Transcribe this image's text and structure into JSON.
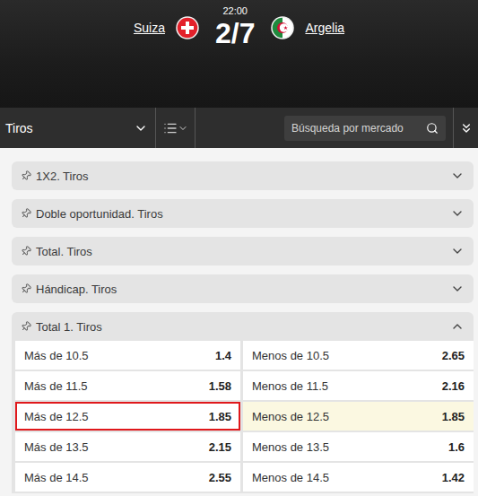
{
  "match": {
    "time": "22:00",
    "score": "2/7",
    "home": {
      "name": "Suiza"
    },
    "away": {
      "name": "Argelia"
    }
  },
  "toolbar": {
    "category": "Tiros",
    "search": {
      "placeholder": "Búsqueda por mercado"
    }
  },
  "markets": [
    {
      "title": "1X2. Tiros",
      "expanded": false,
      "rows": []
    },
    {
      "title": "Doble oportunidad. Tiros",
      "expanded": false,
      "rows": []
    },
    {
      "title": "Total. Tiros",
      "expanded": false,
      "rows": []
    },
    {
      "title": "Hándicap. Tiros",
      "expanded": false,
      "rows": []
    },
    {
      "title": "Total 1. Tiros",
      "expanded": true,
      "rows": [
        {
          "over": {
            "label": "Más de 10.5",
            "odds": "1.4",
            "selected": false,
            "marked": false
          },
          "under": {
            "label": "Menos de 10.5",
            "odds": "2.65",
            "selected": false,
            "marked": false
          }
        },
        {
          "over": {
            "label": "Más de 11.5",
            "odds": "1.58",
            "selected": false,
            "marked": false
          },
          "under": {
            "label": "Menos de 11.5",
            "odds": "2.16",
            "selected": false,
            "marked": false
          }
        },
        {
          "over": {
            "label": "Más de 12.5",
            "odds": "1.85",
            "selected": false,
            "marked": true
          },
          "under": {
            "label": "Menos de 12.5",
            "odds": "1.85",
            "selected": true,
            "marked": false
          }
        },
        {
          "over": {
            "label": "Más de 13.5",
            "odds": "2.15",
            "selected": false,
            "marked": false
          },
          "under": {
            "label": "Menos de 13.5",
            "odds": "1.6",
            "selected": false,
            "marked": false
          }
        },
        {
          "over": {
            "label": "Más de 14.5",
            "odds": "2.55",
            "selected": false,
            "marked": false
          },
          "under": {
            "label": "Menos de 14.5",
            "odds": "1.42",
            "selected": false,
            "marked": false
          }
        }
      ]
    }
  ]
}
